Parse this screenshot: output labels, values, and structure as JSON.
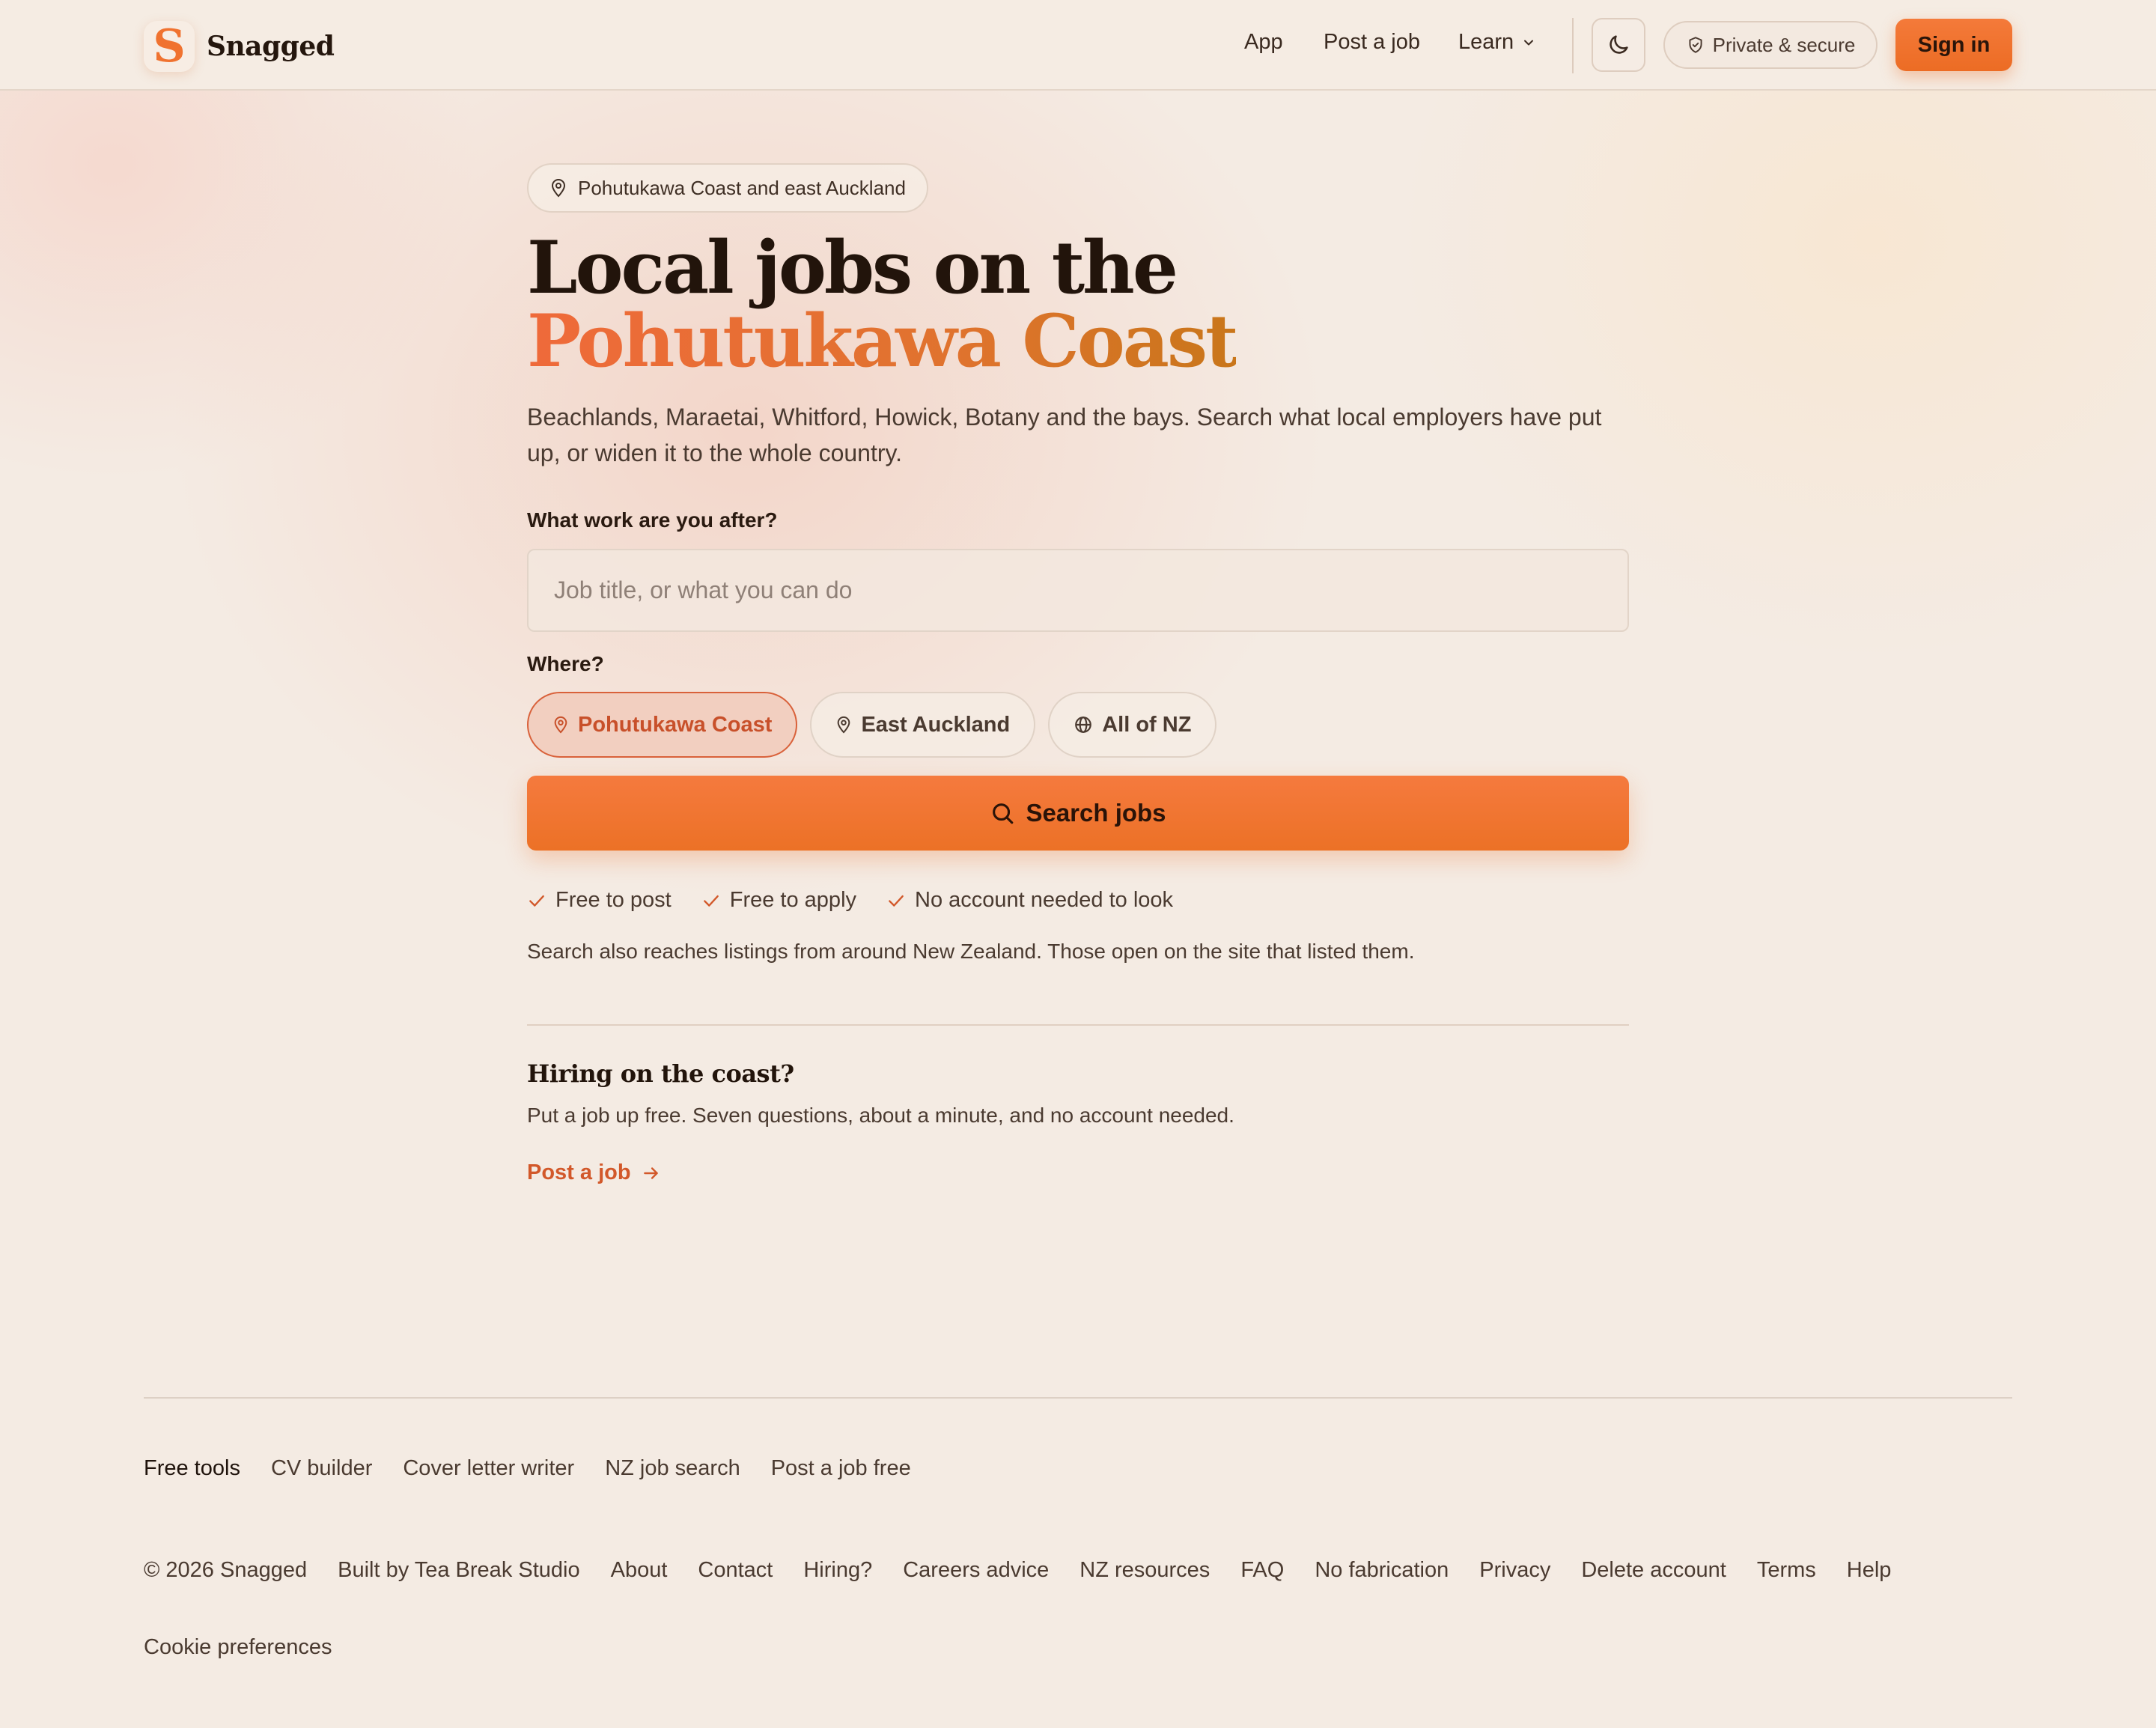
{
  "brand": {
    "logo_letter": "S",
    "name": "Snagged",
    "accent": "#f0722f"
  },
  "nav": {
    "app": "App",
    "post_job": "Post a job",
    "learn": "Learn",
    "private": "Private & secure",
    "sign_in": "Sign in"
  },
  "hero": {
    "location_pill": "Pohutukawa Coast and east Auckland",
    "title_line1": "Local jobs on the",
    "title_line2": "Pohutukawa Coast",
    "lede": "Beachlands, Maraetai, Whitford, Howick, Botany and the bays. Search what local employers have put up, or widen it to the whole country."
  },
  "search": {
    "what_label": "What work are you after?",
    "query_value": "",
    "query_placeholder": "Job title, or what you can do",
    "where_label": "Where?",
    "locations": [
      {
        "label": "Pohutukawa Coast",
        "icon": "pin-icon",
        "selected": true
      },
      {
        "label": "East Auckland",
        "icon": "pin-icon",
        "selected": false
      },
      {
        "label": "All of NZ",
        "icon": "globe-icon",
        "selected": false
      }
    ],
    "button": "Search jobs",
    "perks": [
      "Free to post",
      "Free to apply",
      "No account needed to look"
    ],
    "note": "Search also reaches listings from around New Zealand. Those open on the site that listed them."
  },
  "hiring": {
    "heading": "Hiring on the coast?",
    "text": "Put a job up free. Seven questions, about a minute, and no account needed.",
    "link": "Post a job"
  },
  "footer": {
    "tools_heading": "Free tools",
    "tools": [
      "CV builder",
      "Cover letter writer",
      "NZ job search",
      "Post a job free"
    ],
    "copyright": "© 2026 Snagged",
    "links": [
      "Built by Tea Break Studio",
      "About",
      "Contact",
      "Hiring?",
      "Careers advice",
      "NZ resources",
      "FAQ",
      "No fabrication",
      "Privacy",
      "Delete account",
      "Terms",
      "Help"
    ],
    "cookie": "Cookie preferences"
  }
}
